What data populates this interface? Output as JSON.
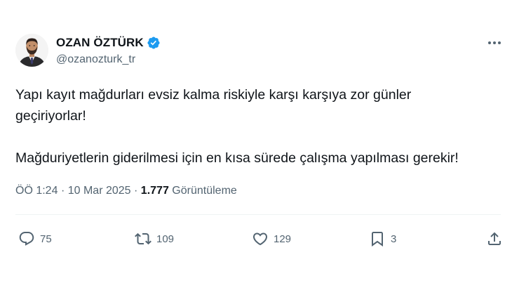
{
  "author": {
    "display_name": "OZAN ÖZTÜRK",
    "handle": "@ozanozturk_tr",
    "avatar_icon": "avatar-photo",
    "verified_icon": "verified-badge-icon",
    "verified_color": "#1d9bf0"
  },
  "tweet": {
    "line1": "Yapı kayıt mağdurları evsiz kalma riskiyle karşı karşıya zor günler",
    "line2": "geçiriyorlar!",
    "line3": "Mağduriyetlerin giderilmesi için en kısa sürede çalışma yapılması gerekir!"
  },
  "meta": {
    "time": "ÖÖ 1:24",
    "separator": "·",
    "date": "10 Mar 2025",
    "views_count": "1.777",
    "views_label": "Görüntüleme"
  },
  "actions": {
    "reply_count": "75",
    "retweet_count": "109",
    "like_count": "129",
    "bookmark_count": "3"
  },
  "icons": {
    "more": "more-dots-icon",
    "reply": "reply-icon",
    "retweet": "retweet-icon",
    "like": "heart-icon",
    "bookmark": "bookmark-icon",
    "share": "share-icon"
  },
  "colors": {
    "text": "#0f1419",
    "secondary": "#536471",
    "accent": "#1d9bf0"
  }
}
